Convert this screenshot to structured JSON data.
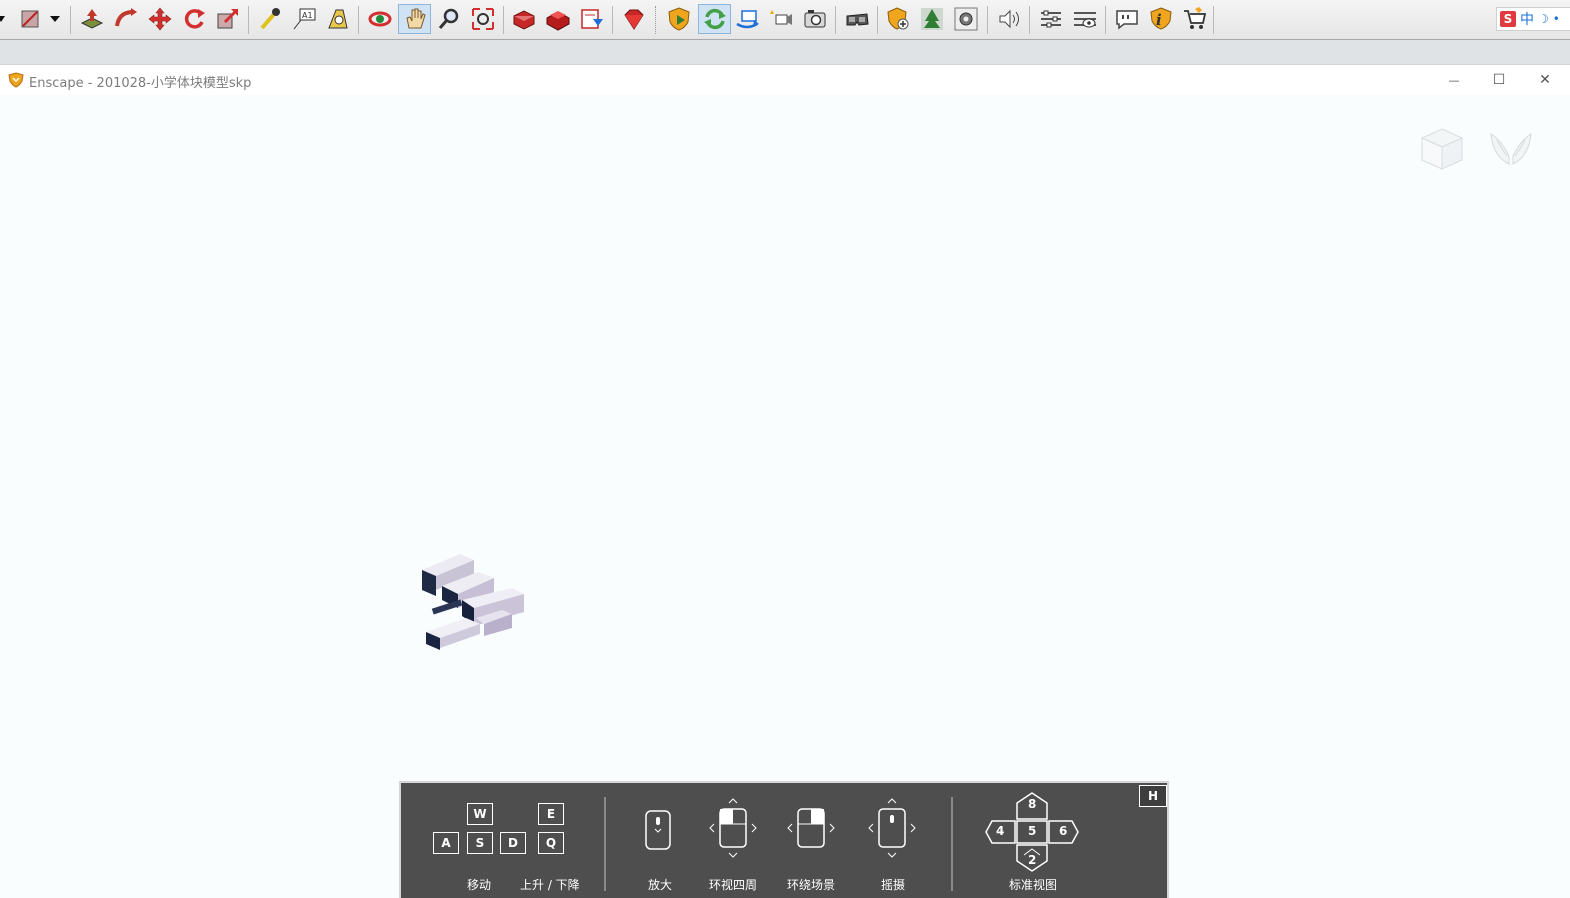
{
  "toolbar": {
    "icons": [
      "select-dropdown-icon",
      "paint-bucket-icon",
      "dropdown-arrow-icon",
      "push-pull-icon",
      "follow-me-icon",
      "move-icon",
      "rotate-icon",
      "scale-icon",
      "tape-measure-icon",
      "text-icon",
      "3d-text-icon",
      "orbit-icon",
      "pan-icon",
      "zoom-icon",
      "zoom-extents-icon",
      "3d-warehouse-icon",
      "extension-warehouse-icon",
      "layout-icon",
      "ruby-console-icon",
      "enscape-start-icon",
      "enscape-live-update-icon",
      "enscape-sync-views-icon",
      "enscape-views-icon",
      "enscape-screenshot-icon",
      "enscape-vr-icon",
      "enscape-asset-library-icon",
      "enscape-material-editor-icon",
      "enscape-settings-icon",
      "enscape-sound-icon",
      "enscape-visual-settings-icon",
      "enscape-view-settings-icon",
      "enscape-feedback-icon",
      "enscape-about-icon",
      "enscape-licensing-icon"
    ],
    "ime": {
      "logo": "S",
      "mode": "中",
      "moon": "☽",
      "dot": "•"
    }
  },
  "window": {
    "title": "Enscape - 201028-小学体块模型skp",
    "minimize": "—",
    "maximize": "☐",
    "close": "✕"
  },
  "help": {
    "h_key": "H",
    "keys": {
      "w": "W",
      "a": "A",
      "s": "S",
      "d": "D",
      "e": "E",
      "q": "Q"
    },
    "labels": {
      "move": "移动",
      "up_down": "上升 / 下降",
      "zoom": "放大",
      "look_around": "环视四周",
      "orbit": "环绕场景",
      "pan": "摇摄",
      "standard_views": "标准视图"
    },
    "numpad": {
      "top": "8",
      "left": "4",
      "center": "5",
      "right": "6",
      "bottom": "2"
    }
  }
}
